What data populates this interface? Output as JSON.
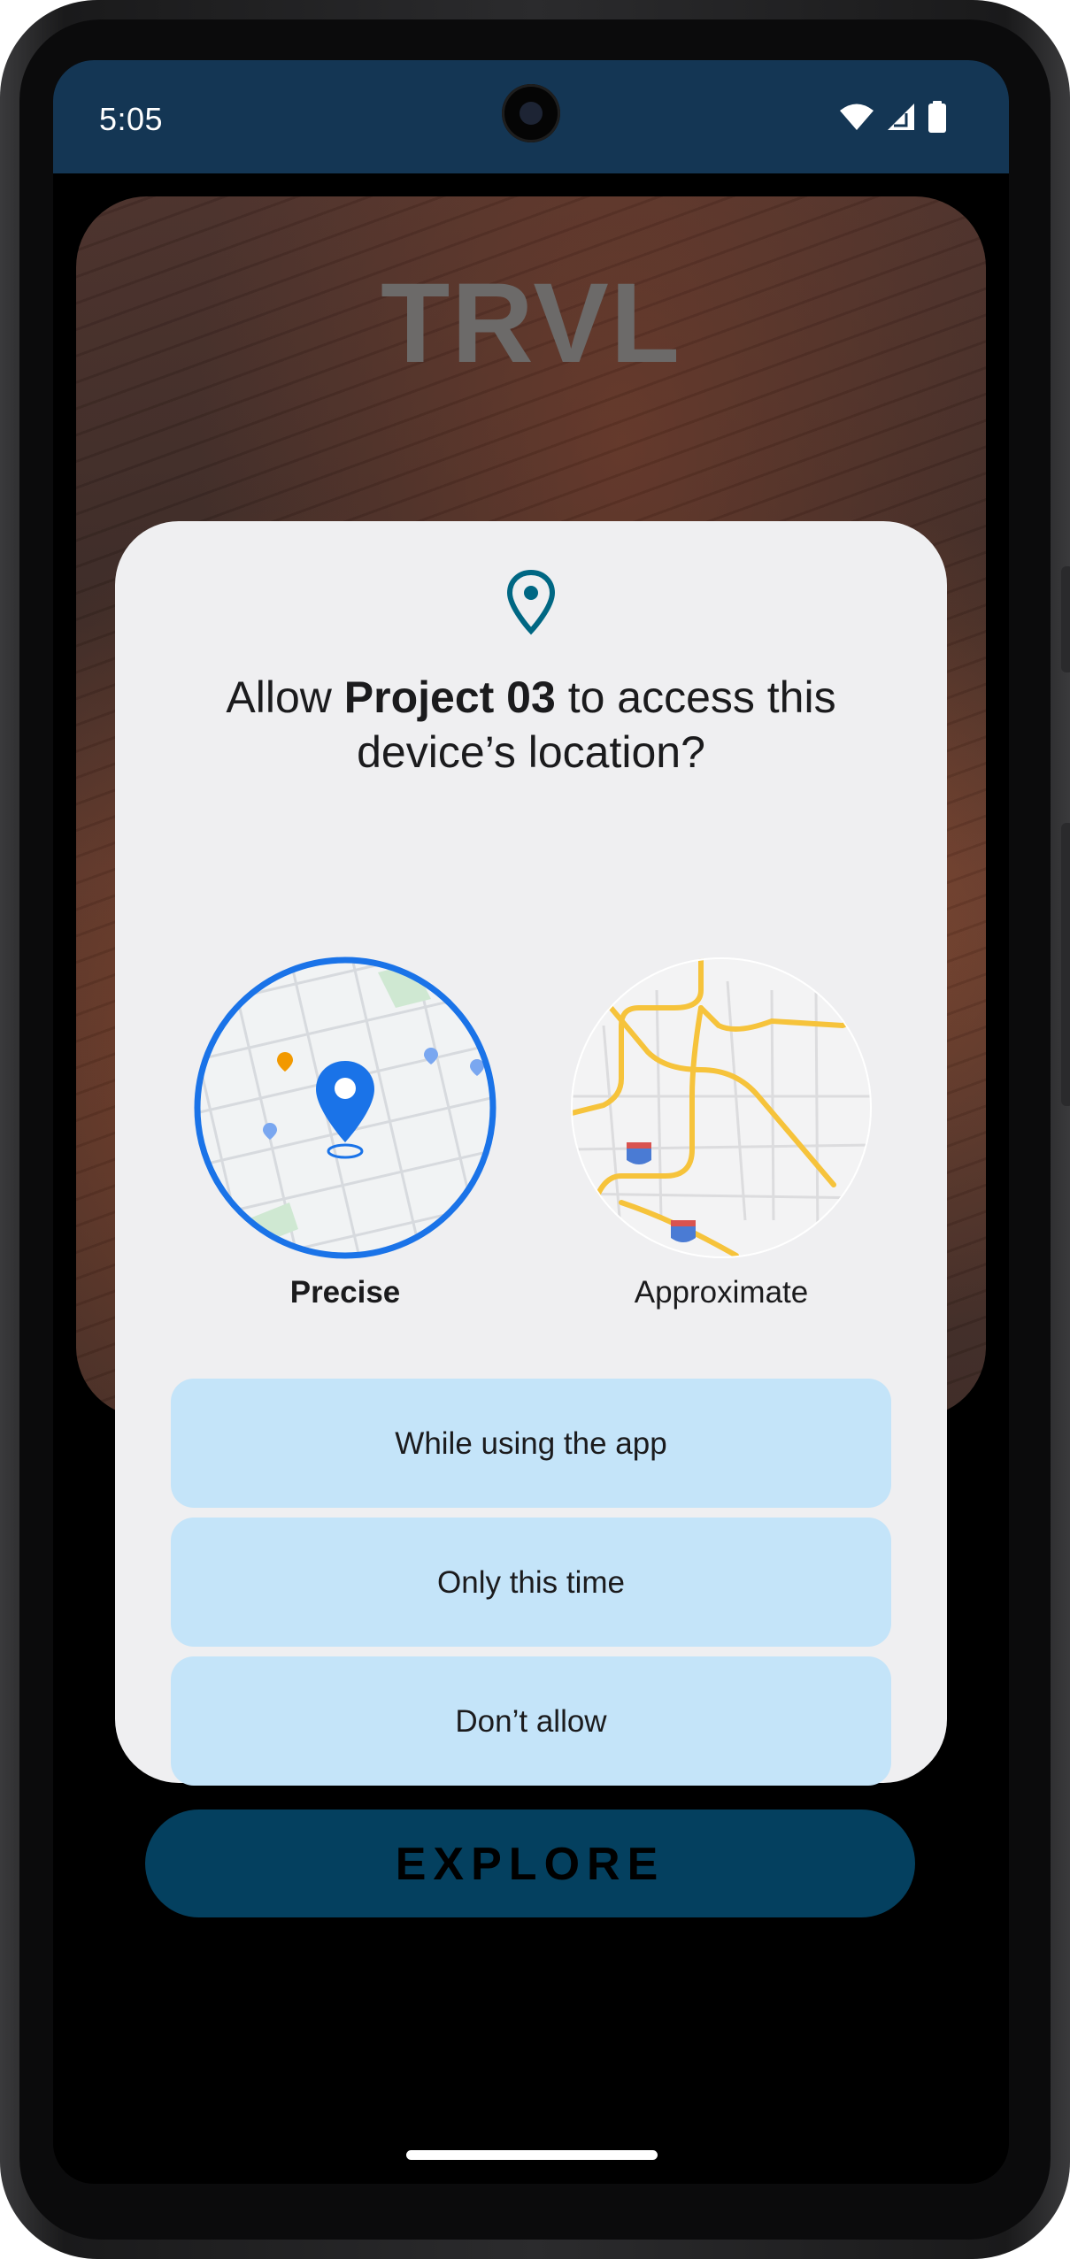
{
  "status_bar": {
    "time": "5:05",
    "icons": [
      "wifi-icon",
      "signal-icon",
      "battery-icon"
    ]
  },
  "app": {
    "logo_text": "TRVL",
    "explore_label": "EXPLORE"
  },
  "dialog": {
    "title_prefix": "Allow ",
    "app_name": "Project 03",
    "title_suffix": " to access this device’s location?",
    "options": {
      "precise_label": "Precise",
      "approximate_label": "Approximate",
      "selected": "Precise"
    },
    "buttons": {
      "while_using": "While using the app",
      "only_this_time": "Only this time",
      "dont_allow": "Don’t allow"
    }
  },
  "colors": {
    "status_bar_bg": "#143654",
    "dialog_bg": "#efeff1",
    "button_bg": "#c4e4f9",
    "accent_blue": "#1a73e8",
    "icon_teal": "#006783",
    "explore_bg": "#04405f"
  }
}
